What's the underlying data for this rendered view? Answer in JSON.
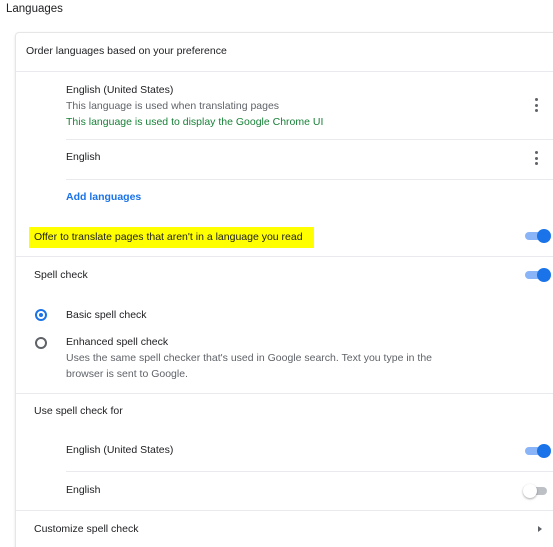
{
  "section_title": "Languages",
  "order_header": "Order languages based on your preference",
  "languages": [
    {
      "name": "English (United States)",
      "line1": "This language is used when translating pages",
      "line2": "This language is used to display the Google Chrome UI"
    },
    {
      "name": "English"
    }
  ],
  "add_languages": "Add languages",
  "offer_translate": {
    "label": "Offer to translate pages that aren't in a language you read",
    "enabled": true
  },
  "spell_check": {
    "label": "Spell check",
    "enabled": true,
    "options": [
      {
        "label": "Basic spell check",
        "selected": true
      },
      {
        "label": "Enhanced spell check",
        "desc_line1": "Uses the same spell checker that's used in Google search. Text you type in the",
        "desc_line2": "browser is sent to Google.",
        "selected": false
      }
    ]
  },
  "use_spell_check_for": {
    "label": "Use spell check for",
    "items": [
      {
        "label": "English (United States)",
        "enabled": true
      },
      {
        "label": "English",
        "enabled": false
      }
    ]
  },
  "customize": "Customize spell check",
  "colors": {
    "accent": "#1a73e8",
    "green": "#188038",
    "highlight": "#ffff00"
  }
}
